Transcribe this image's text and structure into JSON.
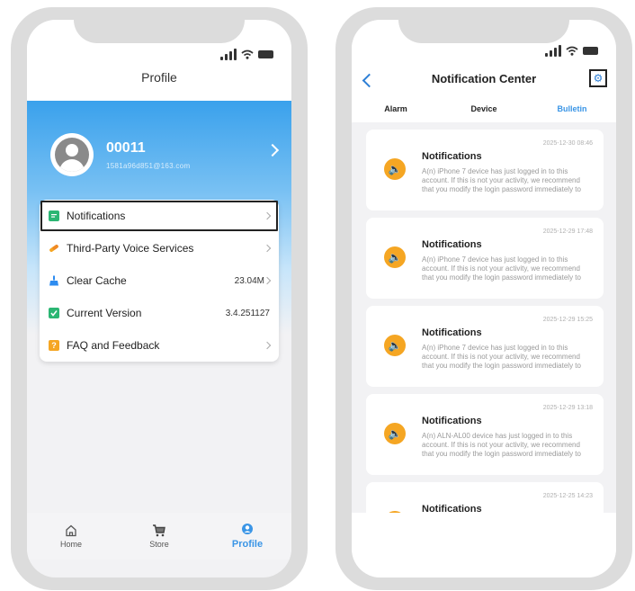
{
  "profile_screen": {
    "title": "Profile",
    "user": {
      "name": "00011",
      "email": "1581a96d851@163.com"
    },
    "menu": [
      {
        "label": "Notifications",
        "value": "",
        "icon": "message-icon",
        "color": "#2bb673"
      },
      {
        "label": "Third-Party Voice Services",
        "value": "",
        "icon": "link-icon",
        "color": "#f5a623"
      },
      {
        "label": "Clear Cache",
        "value": "23.04M",
        "icon": "broom-icon",
        "color": "#2d8cf0"
      },
      {
        "label": "Current Version",
        "value": "3.4.251127",
        "icon": "version-icon",
        "color": "#2bb673"
      },
      {
        "label": "FAQ and Feedback",
        "value": "",
        "icon": "help-icon",
        "color": "#f5a623"
      }
    ],
    "tabs": [
      {
        "label": "Home",
        "icon": "home-icon"
      },
      {
        "label": "Store",
        "icon": "cart-icon"
      },
      {
        "label": "Profile",
        "icon": "profile-icon"
      }
    ]
  },
  "notification_screen": {
    "title": "Notification Center",
    "segments": [
      "Alarm",
      "Device",
      "Bulletin"
    ],
    "active_segment": "Bulletin",
    "cards": [
      {
        "title": "Notifications",
        "time": "2025-12-30 08:46",
        "text": "A(n) iPhone 7 device has just logged in to this account. If this is not your activity, we recommend that you modify the login password immediately to"
      },
      {
        "title": "Notifications",
        "time": "2025-12-29 17:48",
        "text": "A(n) iPhone 7 device has just logged in to this account. If this is not your activity, we recommend that you modify the login password immediately to"
      },
      {
        "title": "Notifications",
        "time": "2025-12-29 15:25",
        "text": "A(n) iPhone 7 device has just logged in to this account. If this is not your activity, we recommend that you modify the login password immediately to"
      },
      {
        "title": "Notifications",
        "time": "2025-12-29 13:18",
        "text": "A(n) ALN-AL00 device has just logged in to this account. If this is not your activity, we recommend that you modify the login password immediately to"
      },
      {
        "title": "Notifications",
        "time": "2025-12-25 14:23",
        "text": ""
      }
    ]
  },
  "colors": {
    "accent": "#3a95e6",
    "speaker": "#f5a623",
    "highlight_border": "#222222"
  }
}
